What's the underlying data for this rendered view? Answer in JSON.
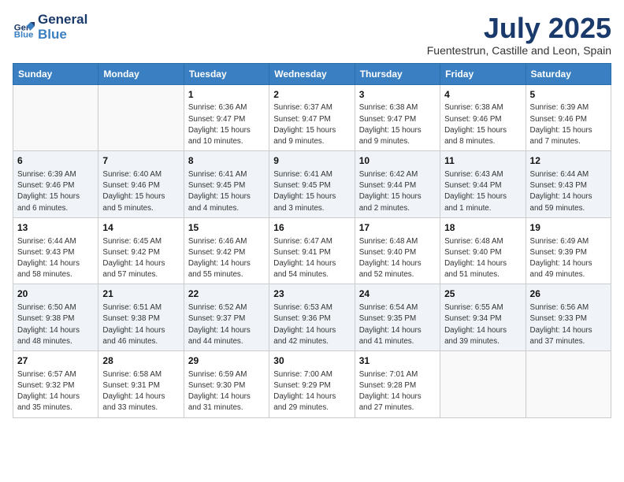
{
  "logo": {
    "line1": "General",
    "line2": "Blue"
  },
  "title": "July 2025",
  "subtitle": "Fuentestrun, Castille and Leon, Spain",
  "weekdays": [
    "Sunday",
    "Monday",
    "Tuesday",
    "Wednesday",
    "Thursday",
    "Friday",
    "Saturday"
  ],
  "weeks": [
    [
      {
        "day": "",
        "detail": ""
      },
      {
        "day": "",
        "detail": ""
      },
      {
        "day": "1",
        "detail": "Sunrise: 6:36 AM\nSunset: 9:47 PM\nDaylight: 15 hours and 10 minutes."
      },
      {
        "day": "2",
        "detail": "Sunrise: 6:37 AM\nSunset: 9:47 PM\nDaylight: 15 hours and 9 minutes."
      },
      {
        "day": "3",
        "detail": "Sunrise: 6:38 AM\nSunset: 9:47 PM\nDaylight: 15 hours and 9 minutes."
      },
      {
        "day": "4",
        "detail": "Sunrise: 6:38 AM\nSunset: 9:46 PM\nDaylight: 15 hours and 8 minutes."
      },
      {
        "day": "5",
        "detail": "Sunrise: 6:39 AM\nSunset: 9:46 PM\nDaylight: 15 hours and 7 minutes."
      }
    ],
    [
      {
        "day": "6",
        "detail": "Sunrise: 6:39 AM\nSunset: 9:46 PM\nDaylight: 15 hours and 6 minutes."
      },
      {
        "day": "7",
        "detail": "Sunrise: 6:40 AM\nSunset: 9:46 PM\nDaylight: 15 hours and 5 minutes."
      },
      {
        "day": "8",
        "detail": "Sunrise: 6:41 AM\nSunset: 9:45 PM\nDaylight: 15 hours and 4 minutes."
      },
      {
        "day": "9",
        "detail": "Sunrise: 6:41 AM\nSunset: 9:45 PM\nDaylight: 15 hours and 3 minutes."
      },
      {
        "day": "10",
        "detail": "Sunrise: 6:42 AM\nSunset: 9:44 PM\nDaylight: 15 hours and 2 minutes."
      },
      {
        "day": "11",
        "detail": "Sunrise: 6:43 AM\nSunset: 9:44 PM\nDaylight: 15 hours and 1 minute."
      },
      {
        "day": "12",
        "detail": "Sunrise: 6:44 AM\nSunset: 9:43 PM\nDaylight: 14 hours and 59 minutes."
      }
    ],
    [
      {
        "day": "13",
        "detail": "Sunrise: 6:44 AM\nSunset: 9:43 PM\nDaylight: 14 hours and 58 minutes."
      },
      {
        "day": "14",
        "detail": "Sunrise: 6:45 AM\nSunset: 9:42 PM\nDaylight: 14 hours and 57 minutes."
      },
      {
        "day": "15",
        "detail": "Sunrise: 6:46 AM\nSunset: 9:42 PM\nDaylight: 14 hours and 55 minutes."
      },
      {
        "day": "16",
        "detail": "Sunrise: 6:47 AM\nSunset: 9:41 PM\nDaylight: 14 hours and 54 minutes."
      },
      {
        "day": "17",
        "detail": "Sunrise: 6:48 AM\nSunset: 9:40 PM\nDaylight: 14 hours and 52 minutes."
      },
      {
        "day": "18",
        "detail": "Sunrise: 6:48 AM\nSunset: 9:40 PM\nDaylight: 14 hours and 51 minutes."
      },
      {
        "day": "19",
        "detail": "Sunrise: 6:49 AM\nSunset: 9:39 PM\nDaylight: 14 hours and 49 minutes."
      }
    ],
    [
      {
        "day": "20",
        "detail": "Sunrise: 6:50 AM\nSunset: 9:38 PM\nDaylight: 14 hours and 48 minutes."
      },
      {
        "day": "21",
        "detail": "Sunrise: 6:51 AM\nSunset: 9:38 PM\nDaylight: 14 hours and 46 minutes."
      },
      {
        "day": "22",
        "detail": "Sunrise: 6:52 AM\nSunset: 9:37 PM\nDaylight: 14 hours and 44 minutes."
      },
      {
        "day": "23",
        "detail": "Sunrise: 6:53 AM\nSunset: 9:36 PM\nDaylight: 14 hours and 42 minutes."
      },
      {
        "day": "24",
        "detail": "Sunrise: 6:54 AM\nSunset: 9:35 PM\nDaylight: 14 hours and 41 minutes."
      },
      {
        "day": "25",
        "detail": "Sunrise: 6:55 AM\nSunset: 9:34 PM\nDaylight: 14 hours and 39 minutes."
      },
      {
        "day": "26",
        "detail": "Sunrise: 6:56 AM\nSunset: 9:33 PM\nDaylight: 14 hours and 37 minutes."
      }
    ],
    [
      {
        "day": "27",
        "detail": "Sunrise: 6:57 AM\nSunset: 9:32 PM\nDaylight: 14 hours and 35 minutes."
      },
      {
        "day": "28",
        "detail": "Sunrise: 6:58 AM\nSunset: 9:31 PM\nDaylight: 14 hours and 33 minutes."
      },
      {
        "day": "29",
        "detail": "Sunrise: 6:59 AM\nSunset: 9:30 PM\nDaylight: 14 hours and 31 minutes."
      },
      {
        "day": "30",
        "detail": "Sunrise: 7:00 AM\nSunset: 9:29 PM\nDaylight: 14 hours and 29 minutes."
      },
      {
        "day": "31",
        "detail": "Sunrise: 7:01 AM\nSunset: 9:28 PM\nDaylight: 14 hours and 27 minutes."
      },
      {
        "day": "",
        "detail": ""
      },
      {
        "day": "",
        "detail": ""
      }
    ]
  ]
}
